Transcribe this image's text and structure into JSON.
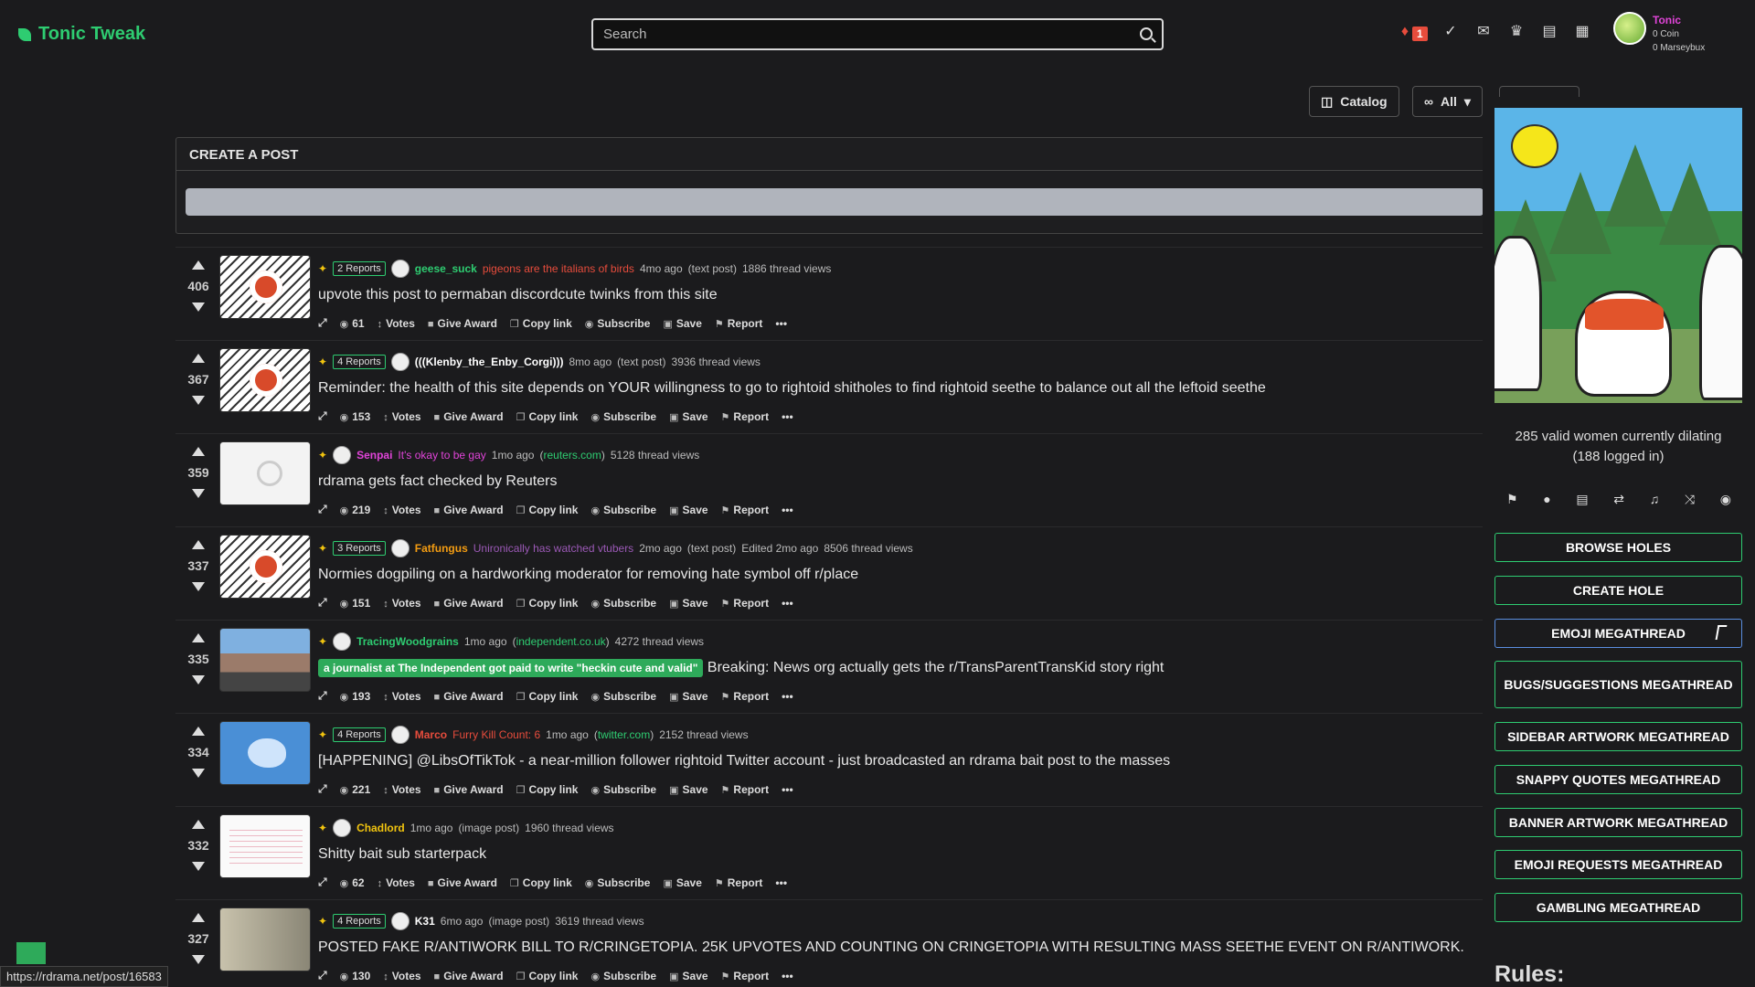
{
  "brand": "Tonic Tweak",
  "search": {
    "placeholder": "Search"
  },
  "header": {
    "notif_count": "1",
    "user_name": "Tonic",
    "coins": "0 Coin",
    "marseybux": "0 Marseybux",
    "icons": [
      "bell-icon",
      "feather-icon",
      "chat-icon",
      "trophy-icon",
      "ticket-icon",
      "store-icon"
    ]
  },
  "filters": {
    "catalog": "Catalog",
    "all": "All"
  },
  "create_post": {
    "header": "CREATE A POST"
  },
  "posts": [
    {
      "score": "406",
      "reports": "2 Reports",
      "user": "geese_suck",
      "user_color": "#2ecc71",
      "flair": "pigeons are the italians of birds",
      "flair_color": "#e74c3c",
      "time": "4mo ago",
      "kind": "(text post)",
      "domain": "",
      "views": "1886 thread views",
      "edited": "",
      "title": "upvote this post to permaban discordcute twinks from this site",
      "comments": "61",
      "thumb": "sigma"
    },
    {
      "score": "367",
      "reports": "4 Reports",
      "user": "(((Klenby_the_Enby_Corgi)))",
      "user_color": "#ffffff",
      "flair": "",
      "flair_color": "#ffffff",
      "time": "8mo ago",
      "kind": "(text post)",
      "domain": "",
      "views": "3936 thread views",
      "edited": "",
      "title": "Reminder: the health of this site depends on YOUR willingness to go to rightoid shitholes to find rightoid seethe to balance out all the leftoid seethe",
      "comments": "153",
      "thumb": "sigma"
    },
    {
      "score": "359",
      "reports": "",
      "user": "Senpai",
      "user_color": "#e044d8",
      "flair": "It's okay to be gay",
      "flair_color": "#e044d8",
      "time": "1mo ago",
      "kind": "",
      "domain": "reuters.com",
      "views": "5128 thread views",
      "edited": "",
      "title": "rdrama gets fact checked by Reuters",
      "comments": "219",
      "thumb": "white"
    },
    {
      "score": "337",
      "reports": "3 Reports",
      "user": "Fatfungus",
      "user_color": "#f39c12",
      "flair": "Unironically has watched vtubers",
      "flair_color": "#9b59b6",
      "time": "2mo ago",
      "kind": "(text post)",
      "domain": "",
      "views": "8506 thread views",
      "edited": "Edited 2mo ago",
      "title": "Normies dogpiling on a hardworking moderator for removing hate symbol off r/place",
      "comments": "151",
      "thumb": "sigma"
    },
    {
      "score": "335",
      "reports": "",
      "user": "TracingWoodgrains",
      "user_color": "#2ecc71",
      "flair": "",
      "flair_color": "#ffffff",
      "time": "1mo ago",
      "kind": "",
      "domain": "independent.co.uk",
      "views": "4272 thread views",
      "edited": "",
      "pill": "a journalist at The Independent got paid to write \"heckin cute and valid\"",
      "title": "Breaking: News org actually gets the r/TransParentTransKid story right",
      "comments": "193",
      "thumb": "street"
    },
    {
      "score": "334",
      "reports": "4 Reports",
      "user": "Marco",
      "user_color": "#e74c3c",
      "flair": "Furry Kill Count: 6",
      "flair_color": "#e74c3c",
      "time": "1mo ago",
      "kind": "",
      "domain": "twitter.com",
      "views": "2152 thread views",
      "edited": "",
      "title": "[HAPPENING] @LibsOfTikTok - a near-million follower rightoid Twitter account - just broadcasted an rdrama bait post to the masses",
      "comments": "221",
      "thumb": "twitter"
    },
    {
      "score": "332",
      "reports": "",
      "user": "Chadlord",
      "user_color": "#f1c40f",
      "flair": "",
      "flair_color": "#ffffff",
      "time": "1mo ago",
      "kind": "(image post)",
      "domain": "",
      "views": "1960 thread views",
      "edited": "",
      "title": "Shitty bait sub starterpack",
      "comments": "62",
      "thumb": "doc"
    },
    {
      "score": "327",
      "reports": "4 Reports",
      "user": "K31",
      "user_color": "#ffffff",
      "flair": "",
      "flair_color": "#ffffff",
      "time": "6mo ago",
      "kind": "(image post)",
      "domain": "",
      "views": "3619 thread views",
      "edited": "",
      "title": "POSTED FAKE R/ANTIWORK BILL TO R/CRINGETOPIA. 25K UPVOTES AND COUNTING ON CRINGETOPIA WITH RESULTING MASS SEETHE EVENT ON R/ANTIWORK.",
      "comments": "130",
      "thumb": "money"
    }
  ],
  "actions": {
    "votes": "Votes",
    "award": "Give Award",
    "copy": "Copy link",
    "subscribe": "Subscribe",
    "save": "Save",
    "report": "Report",
    "more": "•••"
  },
  "sidebar": {
    "online_line1": "285 valid women currently dilating",
    "online_line2": "(188 logged in)",
    "buttons": [
      "BROWSE HOLES",
      "CREATE HOLE",
      "EMOJI MEGATHREAD",
      "BUGS/SUGGESTIONS MEGATHREAD",
      "SIDEBAR ARTWORK MEGATHREAD",
      "SNAPPY QUOTES MEGATHREAD",
      "BANNER ARTWORK MEGATHREAD",
      "EMOJI REQUESTS MEGATHREAD",
      "GAMBLING MEGATHREAD"
    ],
    "rules_heading": "Rules:"
  },
  "status_url": "https://rdrama.net/post/16583"
}
